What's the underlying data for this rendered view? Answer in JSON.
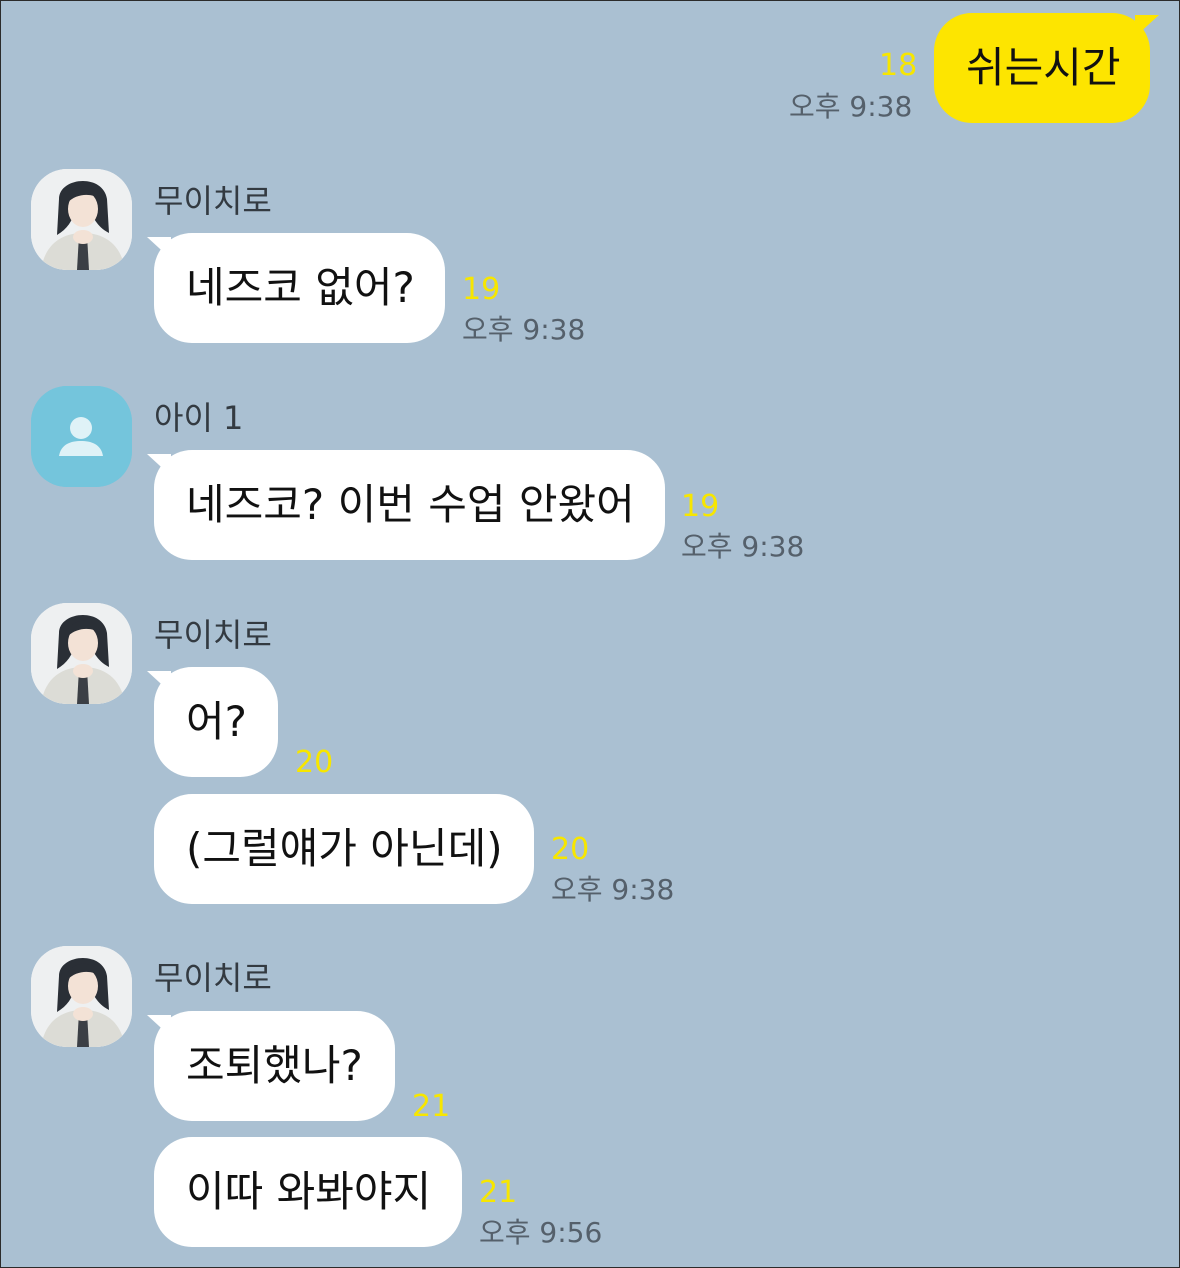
{
  "messages": [
    {
      "sender": "me",
      "text": "쉬는시간",
      "unread": "18",
      "time": "오후 9:38"
    },
    {
      "sender": "무이치로",
      "avatar_icon": "character-avatar-icon",
      "text": "네즈코 없어?",
      "unread": "19",
      "time": "오후 9:38"
    },
    {
      "sender": "아이 1",
      "avatar_icon": "default-person-icon",
      "text": "네즈코? 이번 수업 안왔어",
      "unread": "19",
      "time": "오후 9:38"
    },
    {
      "sender": "무이치로",
      "avatar_icon": "character-avatar-icon",
      "text": "어?",
      "unread": "20",
      "time": ""
    },
    {
      "sender": "",
      "text": "(그럴얘가 아닌데)",
      "unread": "20",
      "time": "오후 9:38"
    },
    {
      "sender": "무이치로",
      "avatar_icon": "character-avatar-icon",
      "text": "조퇴했나?",
      "unread": "21",
      "time": ""
    },
    {
      "sender": "",
      "text": "이따 와봐야지",
      "unread": "21",
      "time": "오후 9:56"
    }
  ],
  "colors": {
    "background": "#aac0d2",
    "my_bubble": "#fde500",
    "other_bubble": "#ffffff",
    "unread_count": "#f7e600",
    "timestamp": "#55606b"
  }
}
